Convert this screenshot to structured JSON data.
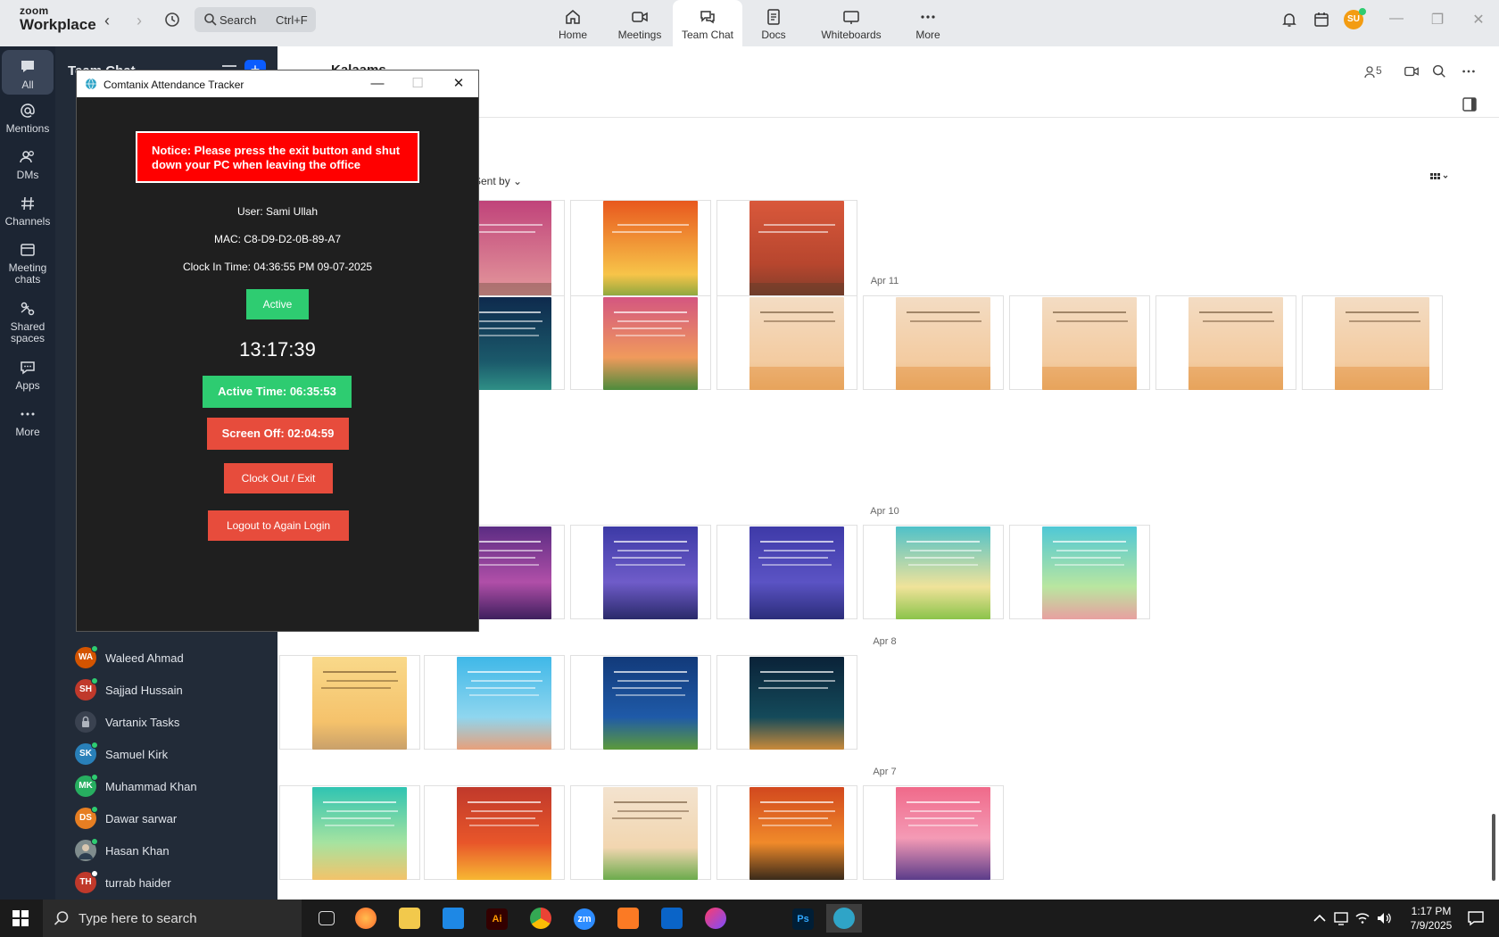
{
  "topbar": {
    "logo_line1": "zoom",
    "logo_line2": "Workplace",
    "search_text": "Search",
    "search_shortcut": "Ctrl+F",
    "tabs": [
      {
        "label": "Home"
      },
      {
        "label": "Meetings"
      },
      {
        "label": "Team Chat"
      },
      {
        "label": "Docs"
      },
      {
        "label": "Whiteboards"
      },
      {
        "label": "More"
      }
    ],
    "avatar_initials": "SU"
  },
  "rail": {
    "items": [
      {
        "label": "All"
      },
      {
        "label": "Mentions"
      },
      {
        "label": "DMs"
      },
      {
        "label": "Channels"
      },
      {
        "label": "Meeting chats"
      },
      {
        "label": "Shared spaces"
      },
      {
        "label": "Apps"
      },
      {
        "label": "More"
      }
    ]
  },
  "chatlist": {
    "title": "Team Chat",
    "contacts": [
      {
        "initials": "WA",
        "name": "Waleed Ahmad",
        "color": "#d35400"
      },
      {
        "initials": "SH",
        "name": "Sajjad Hussain",
        "color": "#c0392b"
      },
      {
        "initials": "",
        "name": "Vartanix Tasks",
        "color": "#3a4250"
      },
      {
        "initials": "SK",
        "name": "Samuel Kirk",
        "color": "#2980b9"
      },
      {
        "initials": "MK",
        "name": "Muhammad Khan",
        "color": "#27ae60"
      },
      {
        "initials": "DS",
        "name": "Dawar sarwar",
        "color": "#e67e22"
      },
      {
        "initials": "",
        "name": "Hasan Khan",
        "color": "#7f8c8d"
      },
      {
        "initials": "TH",
        "name": "turrab haider",
        "color": "#c0392b"
      }
    ]
  },
  "main": {
    "channel_title": "Kalaams",
    "member_count": "5",
    "sort_label": "Sent by",
    "dates": [
      "Apr 11",
      "Apr 10",
      "Apr 8",
      "Apr 7"
    ]
  },
  "tracker": {
    "window_title": "Comtanix Attendance Tracker",
    "notice_line1": "Notice: Please press the exit button and shut",
    "notice_line2": "down your PC when leaving the office",
    "user": "User: Sami Ullah",
    "mac": "MAC: C8-D9-D2-0B-89-A7",
    "clock_in": "Clock In Time: 04:36:55 PM 09-07-2025",
    "status": "Active",
    "timer": "13:17:39",
    "active_time": "Active Time: 06:35:53",
    "screen_off": "Screen Off: 02:04:59",
    "clock_out_label": "Clock Out / Exit",
    "logout_label": "Logout to Again Login"
  },
  "taskbar": {
    "search_placeholder": "Type here to search",
    "time": "1:17 PM",
    "date": "7/9/2025"
  },
  "colors": {
    "notice_red": "#ff0000",
    "active_green": "#2ecc71",
    "danger_red": "#e74c3c",
    "zoom_blue": "#0b5cff"
  }
}
